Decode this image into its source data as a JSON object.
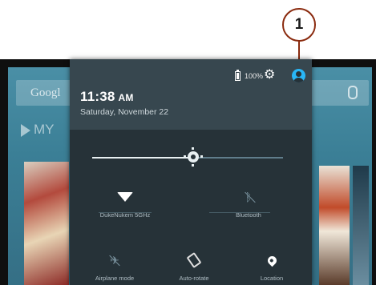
{
  "callout": {
    "number": "1"
  },
  "home": {
    "search_logo": "Googl",
    "play_label": "MY"
  },
  "status_bar": {
    "battery_percent": "100%"
  },
  "header": {
    "time": "11:38",
    "ampm": "AM",
    "date": "Saturday, November 22"
  },
  "brightness": {
    "level_fraction": 0.53
  },
  "tiles": [
    {
      "label": "DukeNukem 5GHz",
      "icon": "wifi-icon",
      "active": true
    },
    {
      "label": "Bluetooth",
      "icon": "bluetooth-icon",
      "active": false
    },
    {
      "label": "Airplane mode",
      "icon": "airplane-icon",
      "active": false
    },
    {
      "label": "Auto-rotate",
      "icon": "rotate-icon",
      "active": true
    },
    {
      "label": "Location",
      "icon": "location-icon",
      "active": true
    }
  ],
  "colors": {
    "accent": "#29b6f6",
    "shade_bg": "#263238",
    "header_bg": "#37474f",
    "callout_border": "#8a2a0e"
  }
}
